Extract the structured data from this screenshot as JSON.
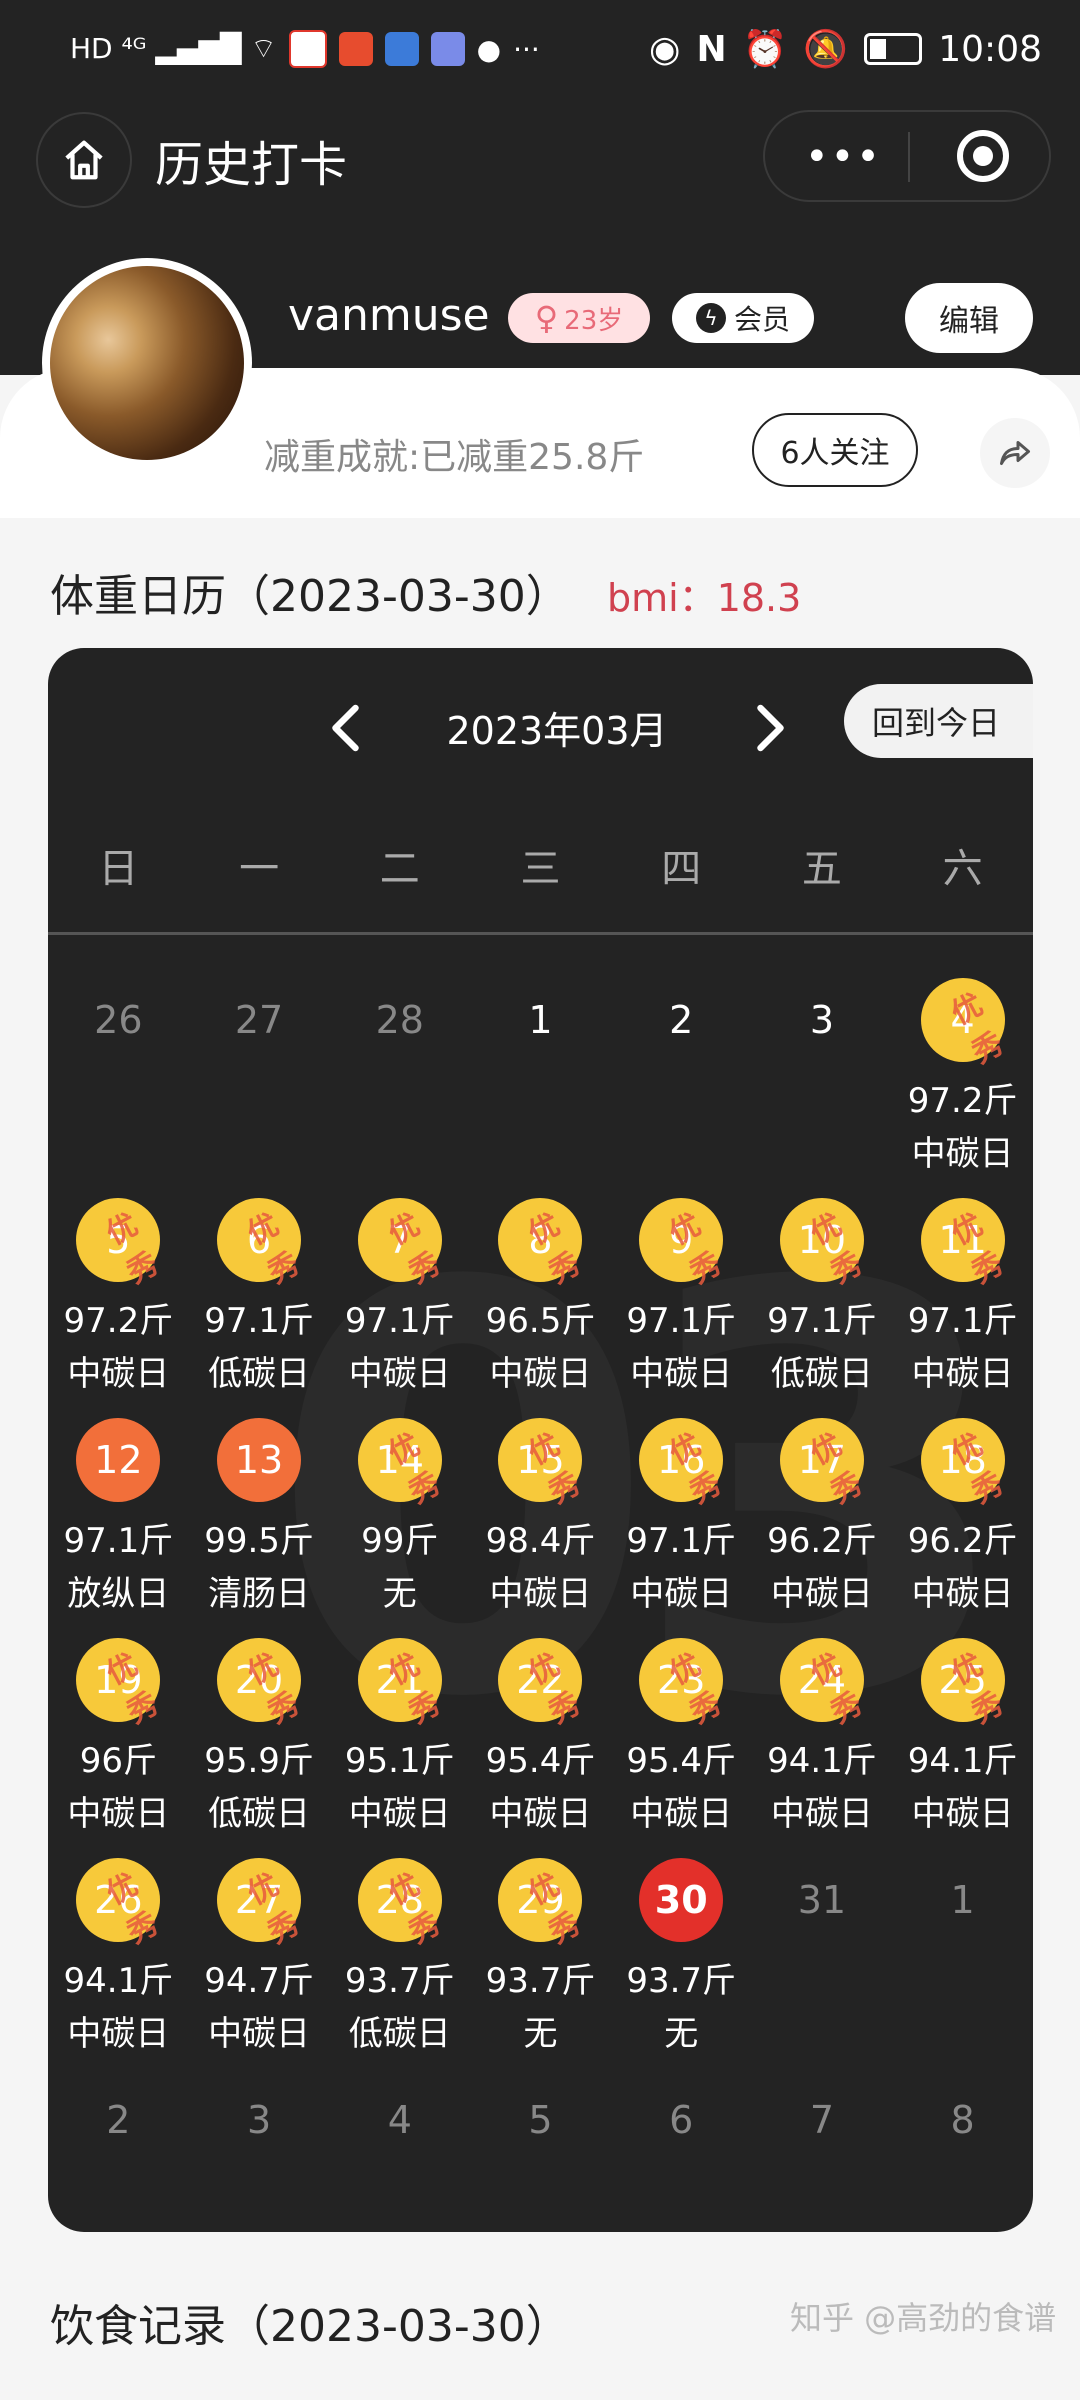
{
  "status_bar": {
    "left": "HD ⁴ᴳ ▂▄▆█ ⌔",
    "time": "10:08"
  },
  "nav": {
    "title": "历史打卡",
    "more_label": "•••"
  },
  "profile": {
    "username": "vanmuse",
    "age": "23岁",
    "gender_symbol": "♀",
    "vip_label": "会员",
    "edit_label": "编辑",
    "achievement": "减重成就:已减重25.8斤",
    "follow_label": "6人关注"
  },
  "weight_calendar": {
    "title": "体重日历（2023-03-30）",
    "bmi": "bmi：18.3",
    "month": "2023年03月",
    "today_label": "回到今日",
    "watermark": "03",
    "stamp_label": "优秀",
    "weekdays": [
      "日",
      "一",
      "二",
      "三",
      "四",
      "五",
      "六"
    ],
    "days": [
      {
        "day": "26",
        "other": true
      },
      {
        "day": "27",
        "other": true
      },
      {
        "day": "28",
        "other": true
      },
      {
        "day": "1"
      },
      {
        "day": "2"
      },
      {
        "day": "3"
      },
      {
        "day": "4",
        "style": "gold",
        "stamp": true,
        "weight": "97.2斤",
        "type": "中碳日"
      },
      {
        "day": "5",
        "style": "gold",
        "stamp": true,
        "weight": "97.2斤",
        "type": "中碳日"
      },
      {
        "day": "6",
        "style": "gold",
        "stamp": true,
        "weight": "97.1斤",
        "type": "低碳日"
      },
      {
        "day": "7",
        "style": "gold",
        "stamp": true,
        "weight": "97.1斤",
        "type": "中碳日"
      },
      {
        "day": "8",
        "style": "gold",
        "stamp": true,
        "weight": "96.5斤",
        "type": "中碳日"
      },
      {
        "day": "9",
        "style": "gold",
        "stamp": true,
        "weight": "97.1斤",
        "type": "中碳日"
      },
      {
        "day": "10",
        "style": "gold",
        "stamp": true,
        "weight": "97.1斤",
        "type": "低碳日"
      },
      {
        "day": "11",
        "style": "gold",
        "stamp": true,
        "weight": "97.1斤",
        "type": "中碳日"
      },
      {
        "day": "12",
        "style": "orange",
        "weight": "97.1斤",
        "type": "放纵日"
      },
      {
        "day": "13",
        "style": "orange",
        "weight": "99.5斤",
        "type": "清肠日"
      },
      {
        "day": "14",
        "style": "gold",
        "stamp": true,
        "weight": "99斤",
        "type": "无"
      },
      {
        "day": "15",
        "style": "gold",
        "stamp": true,
        "weight": "98.4斤",
        "type": "中碳日"
      },
      {
        "day": "16",
        "style": "gold",
        "stamp": true,
        "weight": "97.1斤",
        "type": "中碳日"
      },
      {
        "day": "17",
        "style": "gold",
        "stamp": true,
        "weight": "96.2斤",
        "type": "中碳日"
      },
      {
        "day": "18",
        "style": "gold",
        "stamp": true,
        "weight": "96.2斤",
        "type": "中碳日"
      },
      {
        "day": "19",
        "style": "gold",
        "stamp": true,
        "weight": "96斤",
        "type": "中碳日"
      },
      {
        "day": "20",
        "style": "gold",
        "stamp": true,
        "weight": "95.9斤",
        "type": "低碳日"
      },
      {
        "day": "21",
        "style": "gold",
        "stamp": true,
        "weight": "95.1斤",
        "type": "中碳日"
      },
      {
        "day": "22",
        "style": "gold",
        "stamp": true,
        "weight": "95.4斤",
        "type": "中碳日"
      },
      {
        "day": "23",
        "style": "gold",
        "stamp": true,
        "weight": "95.4斤",
        "type": "中碳日"
      },
      {
        "day": "24",
        "style": "gold",
        "stamp": true,
        "weight": "94.1斤",
        "type": "中碳日"
      },
      {
        "day": "25",
        "style": "gold",
        "stamp": true,
        "weight": "94.1斤",
        "type": "中碳日"
      },
      {
        "day": "26",
        "style": "gold",
        "stamp": true,
        "weight": "94.1斤",
        "type": "中碳日"
      },
      {
        "day": "27",
        "style": "gold",
        "stamp": true,
        "weight": "94.7斤",
        "type": "中碳日"
      },
      {
        "day": "28",
        "style": "gold",
        "stamp": true,
        "weight": "93.7斤",
        "type": "低碳日"
      },
      {
        "day": "29",
        "style": "gold",
        "stamp": true,
        "weight": "93.7斤",
        "type": "无"
      },
      {
        "day": "30",
        "style": "red",
        "weight": "93.7斤",
        "type": "无"
      },
      {
        "day": "31",
        "other": true
      },
      {
        "day": "1",
        "other": true
      },
      {
        "day": "2",
        "other": true
      },
      {
        "day": "3",
        "other": true
      },
      {
        "day": "4",
        "other": true
      },
      {
        "day": "5",
        "other": true
      },
      {
        "day": "6",
        "other": true
      },
      {
        "day": "7",
        "other": true
      },
      {
        "day": "8",
        "other": true
      }
    ]
  },
  "diet": {
    "title": "饮食记录（2023-03-30）"
  },
  "watermark_text": "知乎 @高劲的食谱",
  "colors": {
    "dark_bg": "#232323",
    "gold": "#f7c93a",
    "orange": "#f26f3a",
    "today_red": "#e3302a",
    "bmi_red": "#d0414f"
  }
}
